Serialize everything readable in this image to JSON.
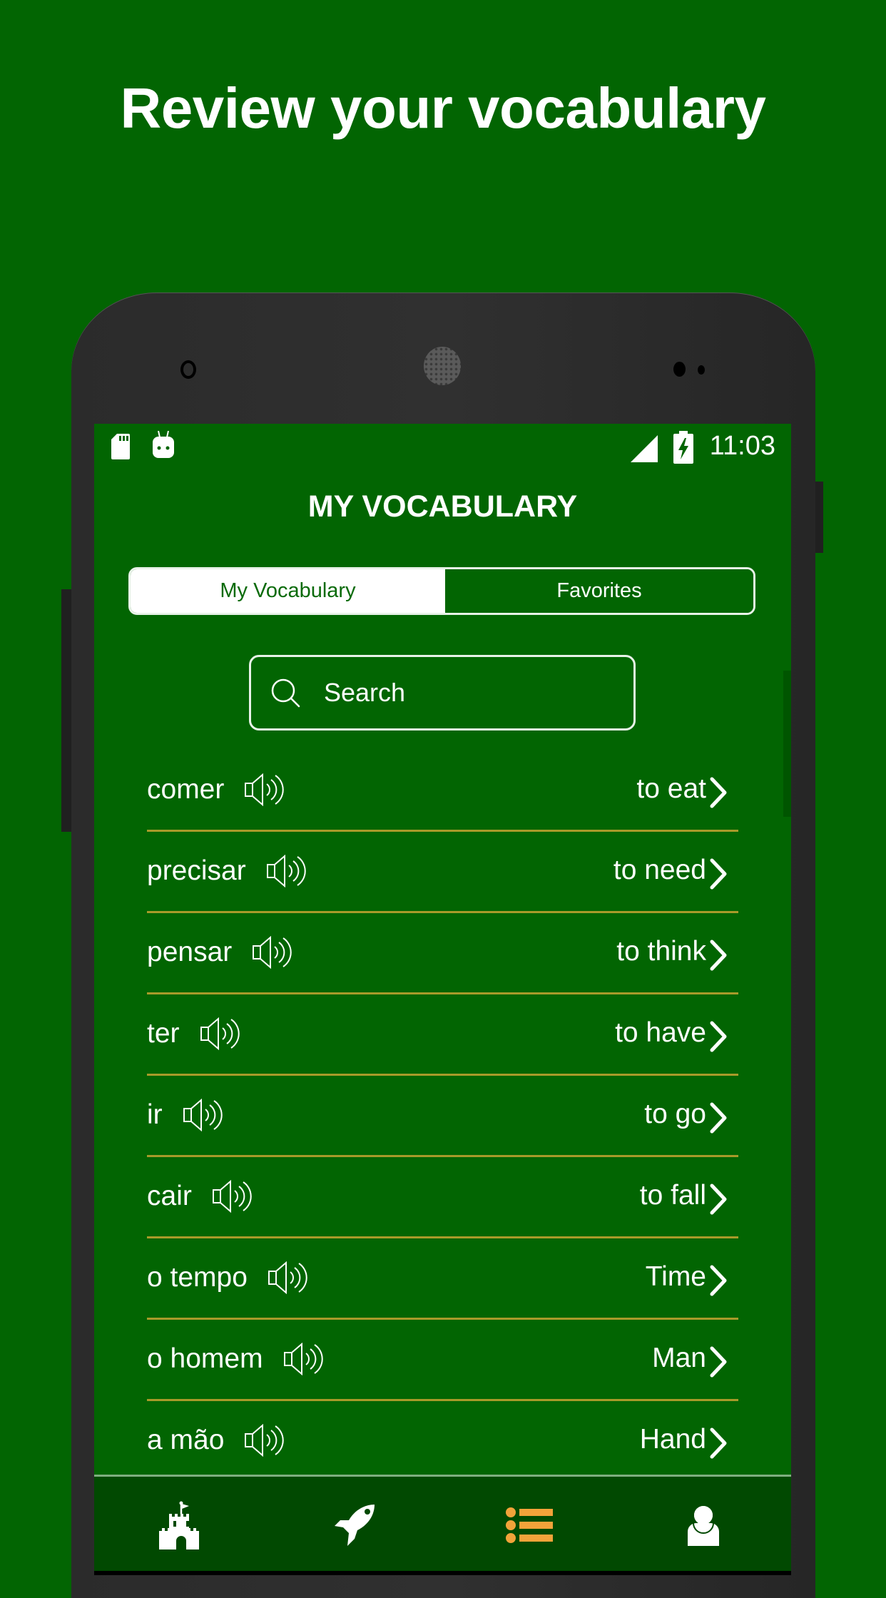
{
  "headline": "Review your vocabulary",
  "status_bar": {
    "left_icons": [
      "sd-card-icon",
      "android-debug-icon"
    ],
    "right_icons": [
      "signal-icon",
      "battery-charging-icon"
    ],
    "time": "11:03"
  },
  "screen_title": "MY VOCABULARY",
  "tabs": [
    {
      "label": "My Vocabulary",
      "active": true
    },
    {
      "label": "Favorites",
      "active": false
    }
  ],
  "search": {
    "placeholder": "Search",
    "value": ""
  },
  "vocabulary": [
    {
      "word": "comer",
      "translation": "to eat"
    },
    {
      "word": "precisar",
      "translation": "to need"
    },
    {
      "word": "pensar",
      "translation": "to think"
    },
    {
      "word": "ter",
      "translation": "to have"
    },
    {
      "word": "ir",
      "translation": "to go"
    },
    {
      "word": "cair",
      "translation": "to fall"
    },
    {
      "word": "o tempo",
      "translation": "Time"
    },
    {
      "word": "o homem",
      "translation": "Man"
    },
    {
      "word": "a mão",
      "translation": "Hand"
    }
  ],
  "bottom_nav": [
    {
      "name": "home",
      "icon": "castle-icon",
      "active": false
    },
    {
      "name": "practice",
      "icon": "rocket-icon",
      "active": false
    },
    {
      "name": "vocabulary",
      "icon": "list-icon",
      "active": true
    },
    {
      "name": "profile",
      "icon": "user-icon",
      "active": false
    }
  ],
  "colors": {
    "background": "#026502",
    "nav_background": "#014901",
    "divider": "#a89a2a",
    "accent": "#f2a33a",
    "phone_body": "#2e2e2e"
  }
}
